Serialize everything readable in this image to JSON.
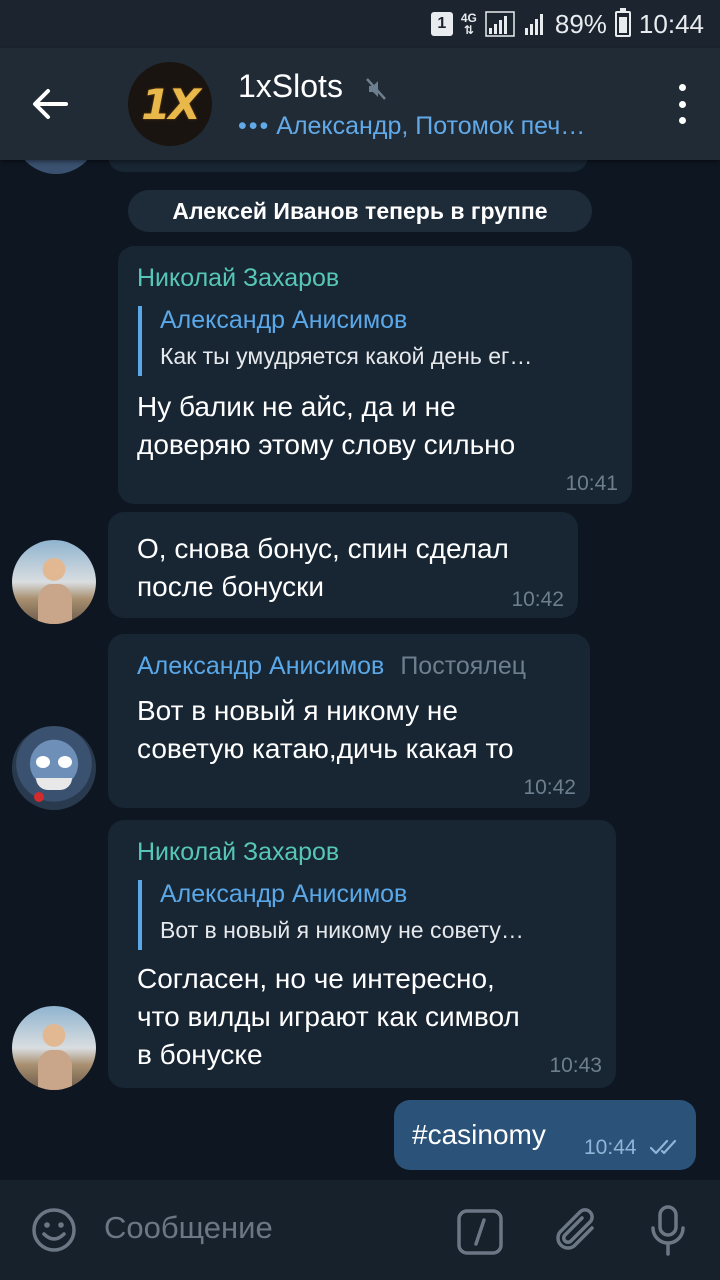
{
  "status_bar": {
    "sim_slot": "1",
    "network": "4G",
    "battery": "89%",
    "clock": "10:44"
  },
  "header": {
    "title": "1xSlots",
    "avatar_text": "1X",
    "subtitle_dots": "•••",
    "subtitle": "Александр, Потомок печ…"
  },
  "service_message": "Алексей Иванов теперь в группе",
  "messages": [
    {
      "sender": "Николай Захаров",
      "reply_name": "Александр Анисимов",
      "reply_text": "Как ты умудряется какой день ег…",
      "text": "Ну балик не айс, да и не\nдоверяю этому слову сильно",
      "time": "10:41"
    },
    {
      "text": "О, снова бонус, спин сделал\nпосле бонуски",
      "time": "10:42"
    },
    {
      "sender": "Александр Анисимов",
      "tag": "Постоялец",
      "text": "Вот в новый я никому не\nсоветую катаю,дичь какая то",
      "time": "10:42"
    },
    {
      "sender": "Николай Захаров",
      "reply_name": "Александр Анисимов",
      "reply_text": "Вот в новый я никому не совету…",
      "text": "Согласен, но че интересно,\nчто вилды играют как символ\nв бонуске",
      "time": "10:43"
    },
    {
      "text": "#casinomy",
      "time": "10:44",
      "status": "read"
    }
  ],
  "composer": {
    "placeholder": "Сообщение"
  },
  "colors": {
    "background": "#0e1621",
    "header": "#202b36",
    "incoming_bubble": "#182533",
    "outgoing_bubble": "#2b5278",
    "accent": "#5aa8e8",
    "sender_green": "#56c7b7"
  }
}
